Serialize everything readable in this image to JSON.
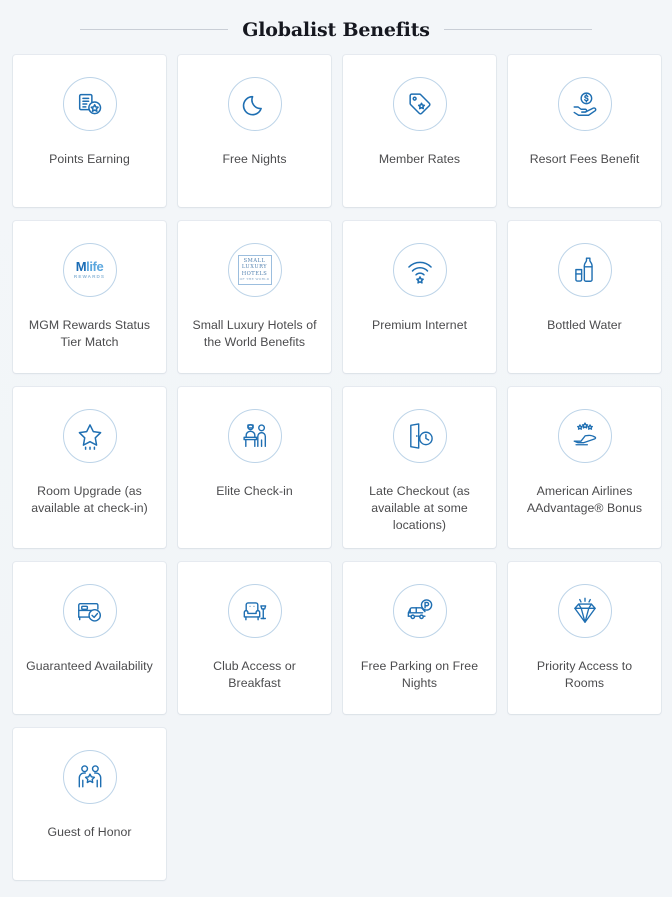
{
  "header": {
    "title": "Globalist Benefits"
  },
  "benefits": [
    {
      "label": "Points Earning",
      "icon": "points-earning-icon"
    },
    {
      "label": "Free Nights",
      "icon": "moon-icon"
    },
    {
      "label": "Member Rates",
      "icon": "price-tag-icon"
    },
    {
      "label": "Resort Fees Benefit",
      "icon": "hand-holding-coin-icon"
    },
    {
      "label": "MGM Rewards Status Tier Match",
      "icon": "mlife-rewards-logo"
    },
    {
      "label": "Small Luxury Hotels of the World Benefits",
      "icon": "small-luxury-hotels-logo"
    },
    {
      "label": "Premium Internet",
      "icon": "wifi-star-icon"
    },
    {
      "label": "Bottled Water",
      "icon": "bottle-glass-icon"
    },
    {
      "label": "Room Upgrade (as available at check-in)",
      "icon": "star-upgrade-icon"
    },
    {
      "label": "Elite Check-in",
      "icon": "front-desk-icon"
    },
    {
      "label": "Late Checkout (as available at some locations)",
      "icon": "door-clock-icon"
    },
    {
      "label": "American Airlines AAdvantage® Bonus",
      "icon": "airplane-stars-icon"
    },
    {
      "label": "Guaranteed Availability",
      "icon": "bed-check-icon"
    },
    {
      "label": "Club Access or Breakfast",
      "icon": "armchair-lamp-icon"
    },
    {
      "label": "Free Parking on Free Nights",
      "icon": "car-parking-icon"
    },
    {
      "label": "Priority Access to Rooms",
      "icon": "diamond-icon"
    },
    {
      "label": "Guest of Honor",
      "icon": "two-people-star-icon"
    }
  ],
  "logos": {
    "mlife": {
      "m": "M",
      "life": "life",
      "rewards": "REWARDS"
    },
    "slh": {
      "line1": "SMALL",
      "line2": "LUXURY",
      "line3": "HOTELS",
      "line4": "OF THE WORLD"
    }
  },
  "colors": {
    "icon_blue": "#1f6fb2",
    "circle_border": "#bdd4e8",
    "card_bg": "#ffffff",
    "page_bg": "#f2f5f8",
    "label_text": "#4b4b4d",
    "title_text": "#15171f"
  }
}
